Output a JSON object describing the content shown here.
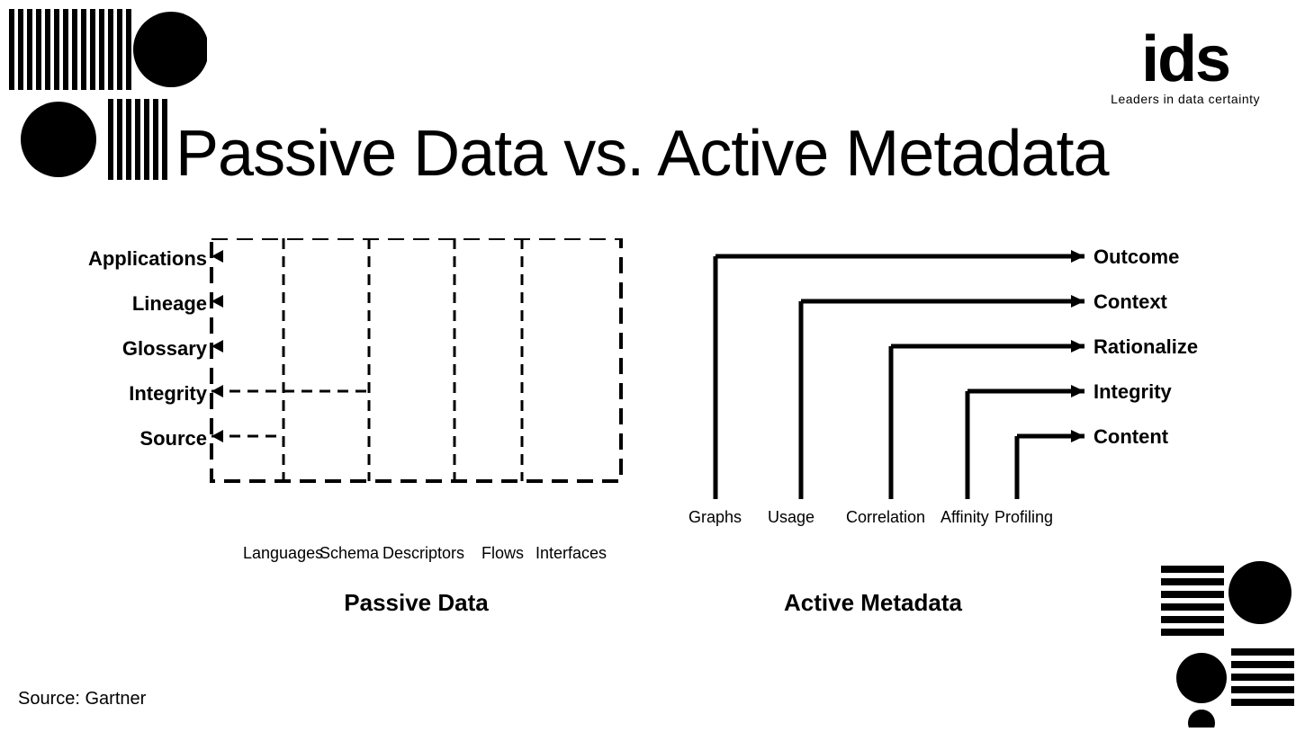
{
  "logo": {
    "ids": "ids",
    "tagline": "Leaders in data certainty"
  },
  "title": "Passive Data vs. Active Metadata",
  "passive": {
    "title": "Passive Data",
    "row_labels": [
      "Applications",
      "Lineage",
      "Glossary",
      "Integrity",
      "Source"
    ],
    "col_labels": [
      "Languages",
      "Schema",
      "Descriptors",
      "Flows",
      "Interfaces"
    ]
  },
  "active": {
    "title": "Active Metadata",
    "right_labels": [
      "Outcome",
      "Context",
      "Rationalize",
      "Integrity",
      "Content"
    ],
    "bottom_labels": [
      "Graphs",
      "Usage",
      "Correlation",
      "Affinity",
      "Profiling"
    ]
  },
  "source": "Source: Gartner"
}
